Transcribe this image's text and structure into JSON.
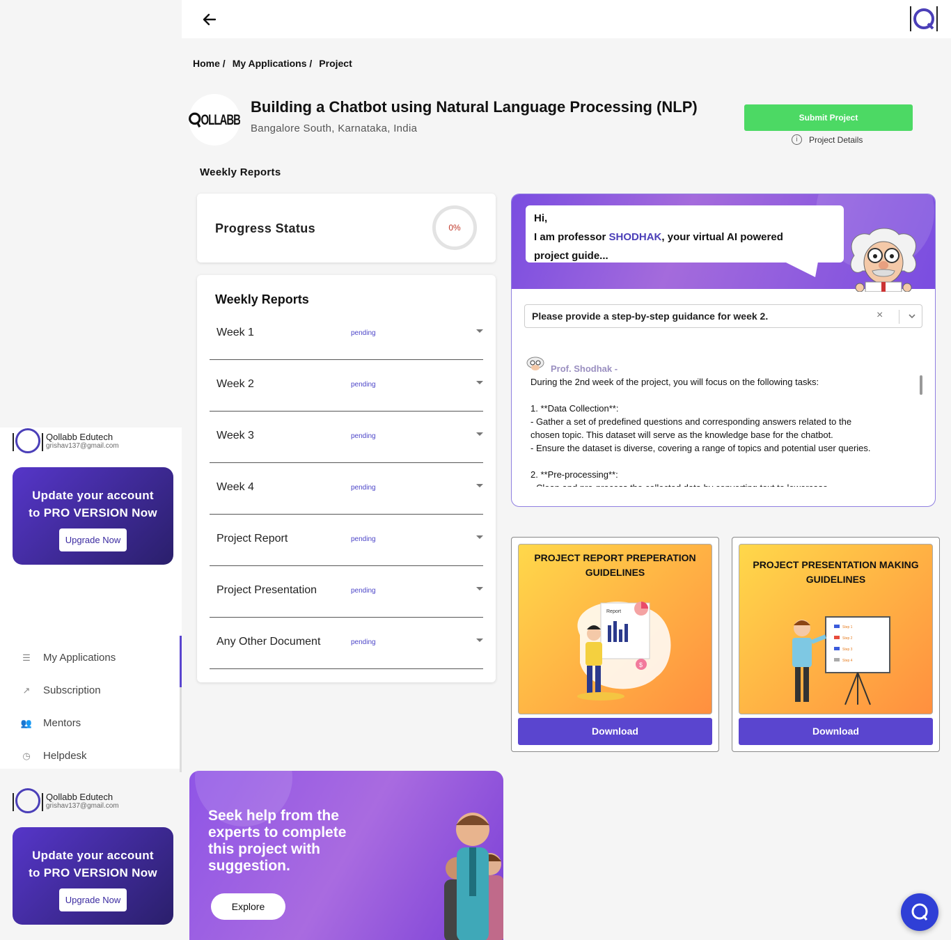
{
  "nav": {
    "back_icon": "arrow-left-icon",
    "logo_icon": "qollabb-logo-icon"
  },
  "breadcrumb": [
    "Home /",
    "My Applications /",
    "Project"
  ],
  "project": {
    "logo_text": "OLLABB",
    "title": "Building a Chatbot using Natural Language Processing (NLP)",
    "location": "Bangalore South, Karnataka, India",
    "submit_label": "Submit Project",
    "details_label": "Project Details"
  },
  "section_title": "Weekly Reports",
  "progress": {
    "label": "Progress Status",
    "value": "0%",
    "percent": 0
  },
  "weekly_reports": {
    "title": "Weekly Reports",
    "items": [
      {
        "label": "Week 1",
        "status": "pending"
      },
      {
        "label": "Week 2",
        "status": "pending"
      },
      {
        "label": "Week 3",
        "status": "pending"
      },
      {
        "label": "Week 4",
        "status": "pending"
      },
      {
        "label": "Project Report",
        "status": "pending"
      },
      {
        "label": "Project Presentation",
        "status": "pending"
      },
      {
        "label": "Any Other Document",
        "status": "pending"
      }
    ]
  },
  "ai_guide": {
    "greeting_1": "Hi,",
    "greeting_2a": "I am professor ",
    "greeting_name": "SHODHAK",
    "greeting_2b": ", your virtual AI powered",
    "greeting_3": "project guide...",
    "select_value": "Please provide a step-by-step guidance for week 2.",
    "speaker": "Prof. Shodhak -",
    "response_lines": [
      "During the 2nd week of the project, you will focus on the following tasks:",
      "",
      "1. **Data Collection**:",
      "- Gather a set of predefined questions and corresponding answers related to the",
      "chosen topic. This dataset will serve as the knowledge base for the chatbot.",
      "- Ensure the dataset is diverse, covering a range of topics and potential user queries.",
      "",
      "2. **Pre-processing**:",
      "- Clean and pre-process the collected data by converting text to lowercase,"
    ]
  },
  "guides": [
    {
      "title": "PROJECT REPORT PREPERATION GUIDELINES",
      "button": "Download",
      "mini_label": "Report"
    },
    {
      "title": "PROJECT PRESENTATION MAKING GUIDELINES",
      "button": "Download",
      "board_items": [
        "Step 1",
        "Step 2",
        "Step 3",
        "Step 4"
      ]
    }
  ],
  "expert_banner": {
    "text": "Seek help from the experts to complete this project with suggestion.",
    "button": "Explore"
  },
  "sidebar": {
    "user_1": {
      "name": "Qollabb Edutech",
      "email": "grishav137@gmail.com"
    },
    "pro_1": {
      "line1": "Update your account",
      "line2": "to PRO VERSION Now",
      "button": "Upgrade Now"
    },
    "items": [
      {
        "label": "My Applications",
        "icon": "list-icon"
      },
      {
        "label": "Subscription",
        "icon": "trend-icon"
      },
      {
        "label": "Mentors",
        "icon": "users-icon"
      },
      {
        "label": "Helpdesk",
        "icon": "clock-icon"
      }
    ],
    "user_2": {
      "name": "Qollabb Edutech",
      "email": "grishav137@gmail.com"
    },
    "pro_2": {
      "line1": "Update your account",
      "line2": "to PRO VERSION Now",
      "button": "Upgrade Now"
    }
  },
  "colors": {
    "accent": "#5a45cf",
    "submit": "#4cd964",
    "pending": "#4c45c8"
  }
}
